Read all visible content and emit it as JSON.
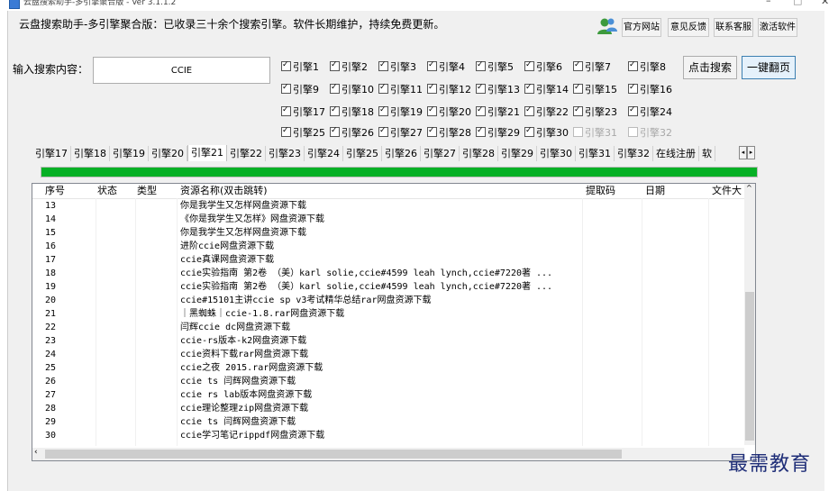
{
  "window": {
    "title": "云盘搜索助手-多引擎聚合版 - Ver 3.1.1.2",
    "minimize_glyph": "–",
    "maximize_glyph": "□",
    "close_glyph": "✕"
  },
  "header": {
    "text": "云盘搜索助手-多引擎聚合版：已收录三十余个搜索引擎。软件长期维护，持续免费更新。",
    "buttons": [
      "官方网站",
      "意见反馈",
      "联系客服",
      "激活软件"
    ]
  },
  "search": {
    "label": "输入搜索内容：",
    "value": "CCIE",
    "search_button": "点击搜索",
    "page_button": "一键翻页"
  },
  "engines": [
    {
      "label": "引擎1",
      "checked": true
    },
    {
      "label": "引擎2",
      "checked": true
    },
    {
      "label": "引擎3",
      "checked": true
    },
    {
      "label": "引擎4",
      "checked": true
    },
    {
      "label": "引擎5",
      "checked": true
    },
    {
      "label": "引擎6",
      "checked": true
    },
    {
      "label": "引擎7",
      "checked": true
    },
    {
      "label": "引擎8",
      "checked": true
    },
    {
      "label": "引擎9",
      "checked": true
    },
    {
      "label": "引擎10",
      "checked": true
    },
    {
      "label": "引擎11",
      "checked": true
    },
    {
      "label": "引擎12",
      "checked": true
    },
    {
      "label": "引擎13",
      "checked": true
    },
    {
      "label": "引擎14",
      "checked": true
    },
    {
      "label": "引擎15",
      "checked": true
    },
    {
      "label": "引擎16",
      "checked": true
    },
    {
      "label": "引擎17",
      "checked": true
    },
    {
      "label": "引擎18",
      "checked": true
    },
    {
      "label": "引擎19",
      "checked": true
    },
    {
      "label": "引擎20",
      "checked": true
    },
    {
      "label": "引擎21",
      "checked": true
    },
    {
      "label": "引擎22",
      "checked": true
    },
    {
      "label": "引擎23",
      "checked": true
    },
    {
      "label": "引擎24",
      "checked": true
    },
    {
      "label": "引擎25",
      "checked": true
    },
    {
      "label": "引擎26",
      "checked": true
    },
    {
      "label": "引擎27",
      "checked": true
    },
    {
      "label": "引擎28",
      "checked": true
    },
    {
      "label": "引擎29",
      "checked": true
    },
    {
      "label": "引擎30",
      "checked": true
    },
    {
      "label": "引擎31",
      "checked": false,
      "disabled": true
    },
    {
      "label": "引擎32",
      "checked": false,
      "disabled": true
    }
  ],
  "tabs": [
    "引擎17",
    "引擎18",
    "引擎19",
    "引擎20",
    "引擎21",
    "引擎22",
    "引擎23",
    "引擎24",
    "引擎25",
    "引擎26",
    "引擎27",
    "引擎28",
    "引擎29",
    "引擎30",
    "引擎31",
    "引擎32",
    "在线注册",
    "软"
  ],
  "active_tab": "引擎21",
  "progress": {
    "percent": 100,
    "color": "#06b025"
  },
  "table": {
    "columns": [
      "序号",
      "状态",
      "类型",
      "资源名称(双击跳转)",
      "提取码",
      "日期",
      "文件大"
    ],
    "rows": [
      [
        "13",
        "你是我学生又怎样网盘资源下载"
      ],
      [
        "14",
        "《你是我学生又怎样》网盘资源下载"
      ],
      [
        "15",
        "你是我学生又怎样网盘资源下载"
      ],
      [
        "16",
        "进阶ccie网盘资源下载"
      ],
      [
        "17",
        "ccie真课网盘资源下载"
      ],
      [
        "18",
        "ccie实验指南 第2卷 （美）karl solie,ccie#4599 leah lynch,ccie#7220著 ..."
      ],
      [
        "19",
        "ccie实验指南 第2卷 （美）karl solie,ccie#4599 leah lynch,ccie#7220著 ..."
      ],
      [
        "20",
        "ccie#15101主讲ccie sp v3考试精华总结rar网盘资源下载"
      ],
      [
        "21",
        "｜黑蜘蛛｜ccie-1.8.rar网盘资源下载"
      ],
      [
        "22",
        "闫辉ccie dc网盘资源下载"
      ],
      [
        "23",
        "ccie-rs版本-k2网盘资源下载"
      ],
      [
        "24",
        "ccie资料下载rar网盘资源下载"
      ],
      [
        "25",
        "ccie之夜 2015.rar网盘资源下载"
      ],
      [
        "26",
        "ccie ts 闫辉网盘资源下载"
      ],
      [
        "27",
        "ccie rs lab版本网盘资源下载"
      ],
      [
        "28",
        "ccie理论整理zip网盘资源下载"
      ],
      [
        "29",
        "ccie ts 闫辉网盘资源下载"
      ],
      [
        "30",
        "ccie学习笔记rippdf网盘资源下载"
      ]
    ]
  },
  "watermark": "最需教育"
}
